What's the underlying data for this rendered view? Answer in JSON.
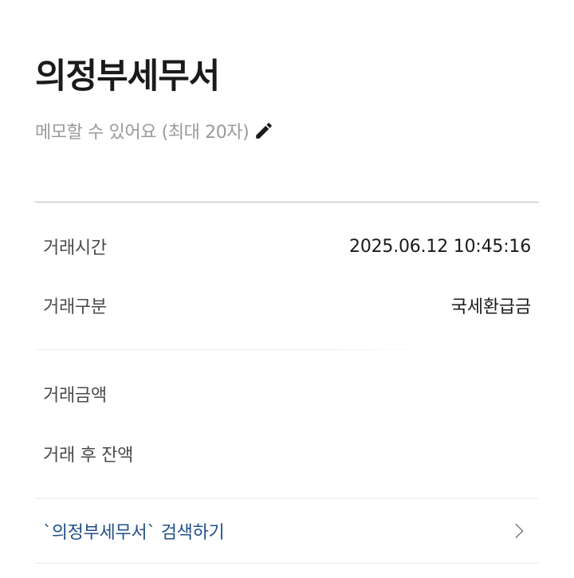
{
  "header": {
    "title": "의정부세무서",
    "memo_placeholder": "메모할 수 있어요 (최대 20자)",
    "edit_icon": "pencil-icon"
  },
  "details": {
    "time_label": "거래시간",
    "time_value": "2025.06.12 10:45:16",
    "type_label": "거래구분",
    "type_value": "국세환급금",
    "amount_label": "거래금액",
    "amount_value": "",
    "balance_label": "거래 후 잔액",
    "balance_value": ""
  },
  "search": {
    "label": "`의정부세무서` 검색하기",
    "icon": "chevron-right-icon"
  },
  "colors": {
    "link": "#1f4f8a",
    "muted": "#9a9a9a",
    "divider": "#b9b9b9"
  }
}
